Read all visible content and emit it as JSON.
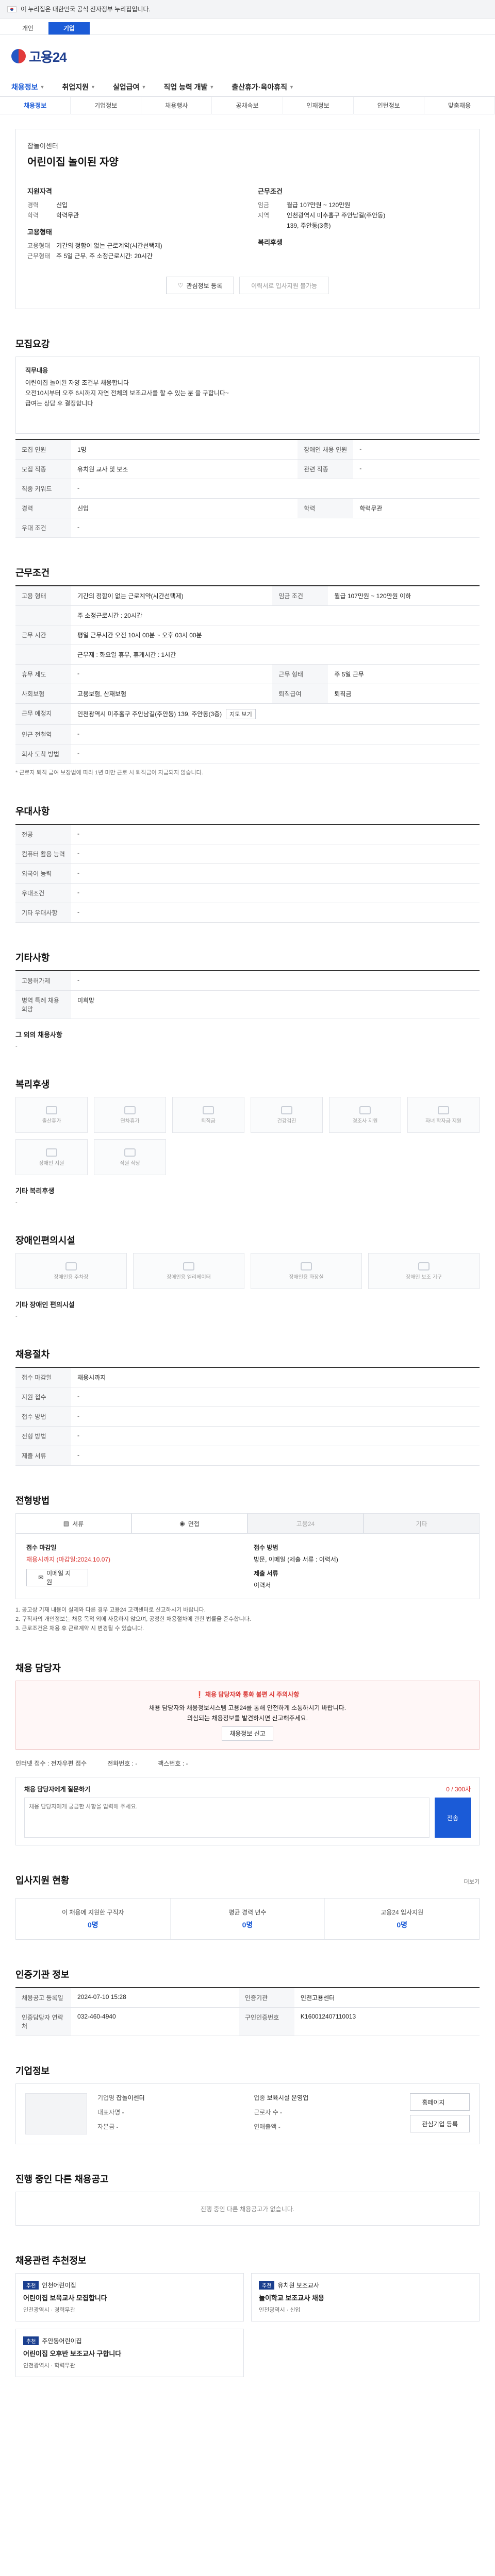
{
  "gov_banner": {
    "text": "이 누리집은 대한민국 공식 전자정부 누리집입니다."
  },
  "top_tabs": [
    "개인",
    "기업"
  ],
  "brand": {
    "name": "고용24"
  },
  "gnb": [
    "채용정보",
    "취업지원",
    "실업급여",
    "직업 능력 개발",
    "출산휴가·육아휴직"
  ],
  "subnav": [
    "채용정보",
    "기업정보",
    "채용행사",
    "공채속보",
    "인재정보",
    "인턴정보",
    "맞춤채용"
  ],
  "job": {
    "company": "잡놀이센터",
    "title": "어린이집 놀이된 자양",
    "left_heading": "지원자격",
    "left_rows": [
      {
        "k": "경력",
        "v": "신입"
      },
      {
        "k": "학력",
        "v": "학력무관"
      }
    ],
    "left_heading2": "고용형태",
    "left_rows2": [
      {
        "k": "고용형태",
        "v": "기간의 정함이 없는 근로계약(시간선택제)"
      },
      {
        "k": "근무형태",
        "v": "주 5일 근무, 주 소정근로시간: 20시간"
      }
    ],
    "right_heading": "근무조건",
    "right_rows": [
      {
        "k": "임금",
        "v": "월급 107만원 ~ 120만원"
      },
      {
        "k": "지역",
        "v": "인천광역시 미추홀구 주안남길(주안동)"
      },
      {
        "k": "",
        "v": "139, 주안동(3층)"
      }
    ],
    "right_heading2": "복리후생",
    "right_rows2": [
      {
        "k": "",
        "v": ""
      }
    ],
    "btn_interest": "관심정보 등록",
    "btn_apply": "이력서로 입사지원 불가능"
  },
  "notice": {
    "heading": "모집요강",
    "lines": [
      "직무내용",
      "어린이집 놀이된 자양 조건부 채용합니다",
      "오전10시부터 오후 6시까지 자연 전체의 보조교사를 할 수 있는 분 을 구합니다~",
      "급여는 상담 후 결정합니다"
    ]
  },
  "recruit_table": [
    {
      "k": "모집 인원",
      "v": "1명",
      "k2": "장애인 채용 인원",
      "v2": "-"
    },
    {
      "k": "모집 직종",
      "v": "유치원 교사 및 보조",
      "k2": "관련 직종",
      "v2": "-"
    },
    {
      "k": "직종 키워드",
      "v": "-",
      "k2": "",
      "v2": ""
    },
    {
      "k": "경력",
      "v": "신입",
      "k2": "학력",
      "v2": "학력무관"
    },
    {
      "k": "우대 조건",
      "v": "-",
      "k2": "",
      "v2": ""
    }
  ],
  "work": {
    "heading": "근무조건",
    "rows": [
      {
        "k": "고용 형태",
        "v": "기간의 정함이 없는 근로계약(시간선택제)",
        "k2": "임금 조건",
        "v2": "월급 107만원 ~ 120만원 이하"
      },
      {
        "k": "",
        "v": "주 소정근로시간 : 20시간",
        "k2": "",
        "v2": ""
      },
      {
        "k": "근무 시간",
        "v": "평일 근무시간  오전 10시 00분 ~ 오후 03시 00분",
        "k2": "",
        "v2": ""
      },
      {
        "k": "",
        "v": "근무제 : 화요일 휴무, 휴게시간 : 1시간",
        "k2": "",
        "v2": ""
      },
      {
        "k": "휴무 제도",
        "v": "-",
        "k2": "근무 형태",
        "v2": "주 5일 근무"
      },
      {
        "k": "사회보험",
        "v": "고용보험, 산재보험",
        "k2": "퇴직급여",
        "v2": "퇴직금"
      },
      {
        "k": "근무 예정지",
        "v": "인천광역시 미추홀구 주안남길(주안동) 139, 주안동(3층)",
        "k2": "",
        "v2": ""
      },
      {
        "k": "인근 전철역",
        "v": "-",
        "k2": "",
        "v2": ""
      },
      {
        "k": "회사 도착 방법",
        "v": "-",
        "k2": "",
        "v2": ""
      }
    ],
    "map_btn": "지도 보기",
    "note": "* 근로자 퇴직 급여 보장법에 따라 1년 미만 근로 시 퇴직금이 지급되지 않습니다."
  },
  "prefer": {
    "heading": "우대사항",
    "rows": [
      {
        "k": "전공",
        "v": "-"
      },
      {
        "k": "컴퓨터 활용 능력",
        "v": "-"
      },
      {
        "k": "외국어 능력",
        "v": "-"
      },
      {
        "k": "우대조건",
        "v": "-"
      },
      {
        "k": "기타 우대사항",
        "v": "-"
      }
    ]
  },
  "other": {
    "heading": "기타사항",
    "rows": [
      {
        "k": "고용허가제",
        "v": "-"
      },
      {
        "k": "병역 특례 채용 희망",
        "v": "미희망"
      }
    ],
    "extra_label": "그 외의 채용사항",
    "extra_value": "-"
  },
  "welfare": {
    "heading": "복리후생",
    "items": [
      "출산휴가",
      "연차휴가",
      "퇴직금",
      "건강검진",
      "경조사 지원",
      "자녀 학자금 지원",
      "장애인 지원",
      "직원 식당",
      "",
      "",
      "",
      ""
    ],
    "other_label": "기타 복리후생",
    "other_value": "-"
  },
  "disability": {
    "heading": "장애인편의시설",
    "items": [
      "장애인용 주차장",
      "장애인용 엘리베이터",
      "장애인용 화장실",
      "장애인 보조 기구"
    ],
    "other_label": "기타 장애인 편의시설",
    "other_value": "-"
  },
  "apply_info": {
    "heading": "채용절차",
    "rows": [
      {
        "k": "접수 마감일",
        "v": "채용시까지",
        "k2": "",
        "v2": ""
      },
      {
        "k": "지원 접수",
        "v": "-",
        "k2": "",
        "v2": ""
      },
      {
        "k": "접수 방법",
        "v": "-",
        "k2": "",
        "v2": ""
      },
      {
        "k": "전형 방법",
        "v": "-",
        "k2": "",
        "v2": ""
      },
      {
        "k": "제출 서류",
        "v": "-",
        "k2": "",
        "v2": ""
      }
    ]
  },
  "apply_methods": {
    "heading": "전형방법",
    "tabs": [
      "서류",
      "면접",
      "고용24",
      "기타"
    ],
    "left_title": "접수 마감일",
    "left_value": "채용시까지 (마감일:2024.10.07)",
    "left_btn": "이메일 지원",
    "right_title": "접수 방법",
    "right_value": "방문, 이메일 (제출 서류 : 이력서)",
    "right_title2": "제출 서류",
    "right_value2": "이력서"
  },
  "notes": [
    "1. 공고상 기재 내용이 실제와 다른 경우 고용24 고객센터로 신고하시기 바랍니다.",
    "2. 구직자의 개인정보는 채용 목적 외에 사용하지 않으며, 공정한 채용절차에 관한 법률을 준수합니다.",
    "3. 근로조건은 채용 후 근로계약 시 변경될 수 있습니다."
  ],
  "contact": {
    "heading": "채용 담당자",
    "warn_title": "채용 담당자와 통화 불편 시 주의사항",
    "warn_lines": [
      "채용 담당자와 채용정보시스템 고용24를 통해 안전하게 소통하시기 바랍니다.",
      "의심되는 채용정보를 발견하시면 신고해주세요."
    ],
    "warn_link": "채용정보 신고",
    "rows": [
      {
        "k": "인터넷 접수",
        "v": "전자우편 접수"
      },
      {
        "k": "전화번호",
        "v": "-"
      },
      {
        "k": "팩스번호",
        "v": "-"
      }
    ]
  },
  "question": {
    "heading": "채용 담당자에게 질문하기",
    "hint": "0 / 300자",
    "placeholder": "채용 담당자에게 궁금한 사항을 입력해 주세요.",
    "send": "전송"
  },
  "stats": {
    "heading": "입사지원 현황",
    "more": "더보기",
    "items": [
      {
        "label": "이 채용에 지원한 구직자",
        "value": "0명"
      },
      {
        "label": "평균 경력 년수",
        "value": "0명"
      },
      {
        "label": "고용24 입사지원",
        "value": "0명"
      }
    ]
  },
  "agency": {
    "heading": "인증기관 정보",
    "rows": [
      {
        "k": "채용공고 등록일",
        "v": "2024-07-10 15:28",
        "k2": "인증기관",
        "v2": "인천고용센터"
      },
      {
        "k": "인증담당자 연락처",
        "v": "032-460-4940",
        "k2": "구인인증번호",
        "v2": "K160012407110013"
      }
    ]
  },
  "company": {
    "heading": "기업정보",
    "rows": [
      {
        "k": "기업명",
        "v": "잡놀이센터"
      },
      {
        "k": "업종",
        "v": "보육시설 운영업"
      },
      {
        "k": "대표자명",
        "v": "-"
      },
      {
        "k": "근로자 수",
        "v": "-"
      },
      {
        "k": "자본금",
        "v": "-"
      },
      {
        "k": "연매출액",
        "v": "-"
      }
    ],
    "btn_homepage": "홈페이지",
    "btn_interest": "관심기업 등록"
  },
  "same_company": {
    "heading": "진행 중인 다른 채용공고",
    "empty": "진행 중인 다른 채용공고가 없습니다."
  },
  "recommend": {
    "heading": "채용관련 추천정보",
    "cards": [
      {
        "badge": "추천",
        "company": "인천어린이집",
        "title": "어린이집 보육교사 모집합니다",
        "meta": "인천광역시 · 경력무관"
      },
      {
        "badge": "추천",
        "company": "유치원 보조교사",
        "title": "놀이학교 보조교사 채용",
        "meta": "인천광역시 · 신입"
      },
      {
        "badge": "추천",
        "company": "주안동어린이집",
        "title": "어린이집 오후반 보조교사 구합니다",
        "meta": "인천광역시 · 학력무관"
      },
      {
        "badge": "추천",
        "company": "",
        "title": "",
        "meta": ""
      }
    ]
  },
  "colors": {
    "primary": "#1b5bd7",
    "accent_red": "#d9322f",
    "navy": "#1f3f8f"
  }
}
